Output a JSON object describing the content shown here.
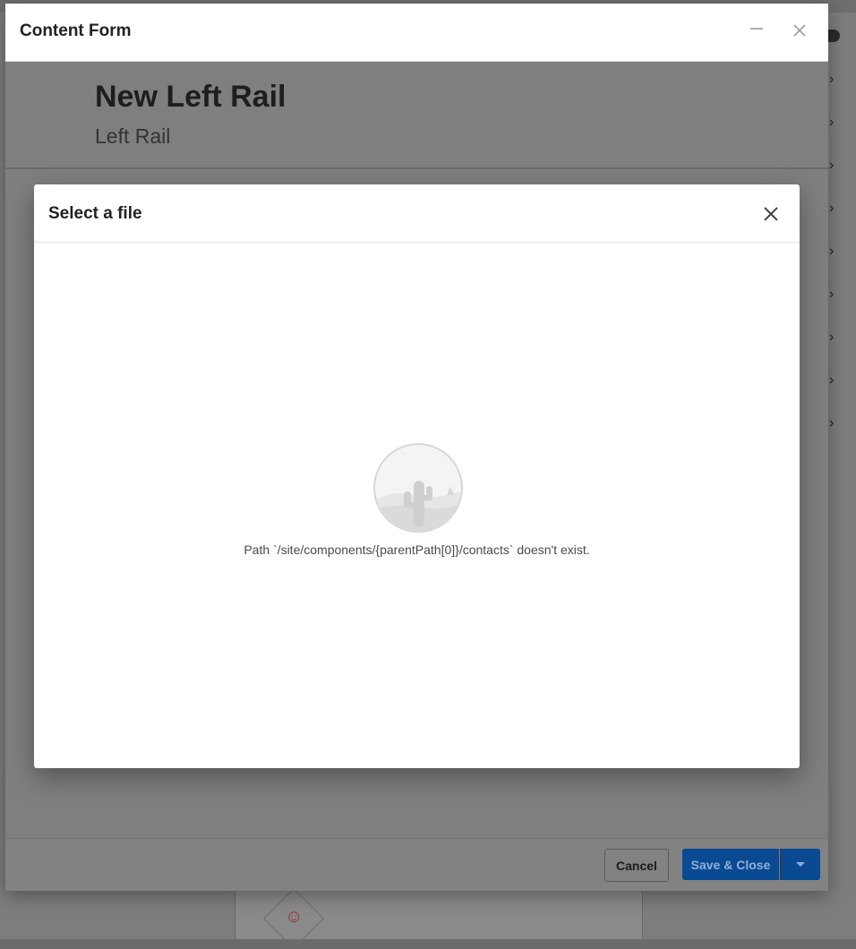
{
  "content_form": {
    "title": "Content Form",
    "heading": "New Left Rail",
    "subheading": "Left Rail",
    "footer": {
      "cancel_label": "Cancel",
      "save_label": "Save & Close"
    }
  },
  "file_dialog": {
    "title": "Select a file",
    "empty_message": "Path `/site/components/{parentPath[0]}/contacts` doesn't exist."
  },
  "colors": {
    "primary_button": "#0a4a93",
    "overlay": "#7f7f7f"
  }
}
